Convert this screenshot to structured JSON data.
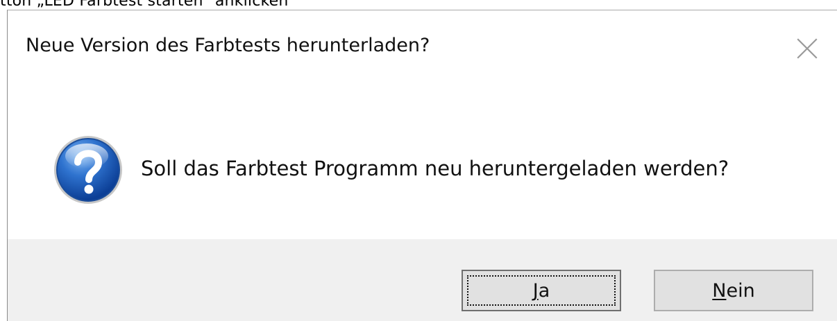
{
  "background_text": {
    "label": "tton „LED Farbtest starten“ anklicken"
  },
  "dialog": {
    "title": "Neue Version des Farbtests herunterladen?",
    "message": "Soll das Farbtest Programm neu heruntergeladen werden?",
    "icons": {
      "question": "question-icon",
      "close": "close-icon"
    },
    "buttons": {
      "yes": {
        "mnemonic": "J",
        "rest": "a"
      },
      "no": {
        "mnemonic": "N",
        "rest": "ein"
      }
    }
  },
  "colors": {
    "button_bar": "#f0f0f0",
    "button_face": "#e1e1e1",
    "question_blue": "#1f5fb8",
    "close_gray": "#9a9a9a"
  }
}
